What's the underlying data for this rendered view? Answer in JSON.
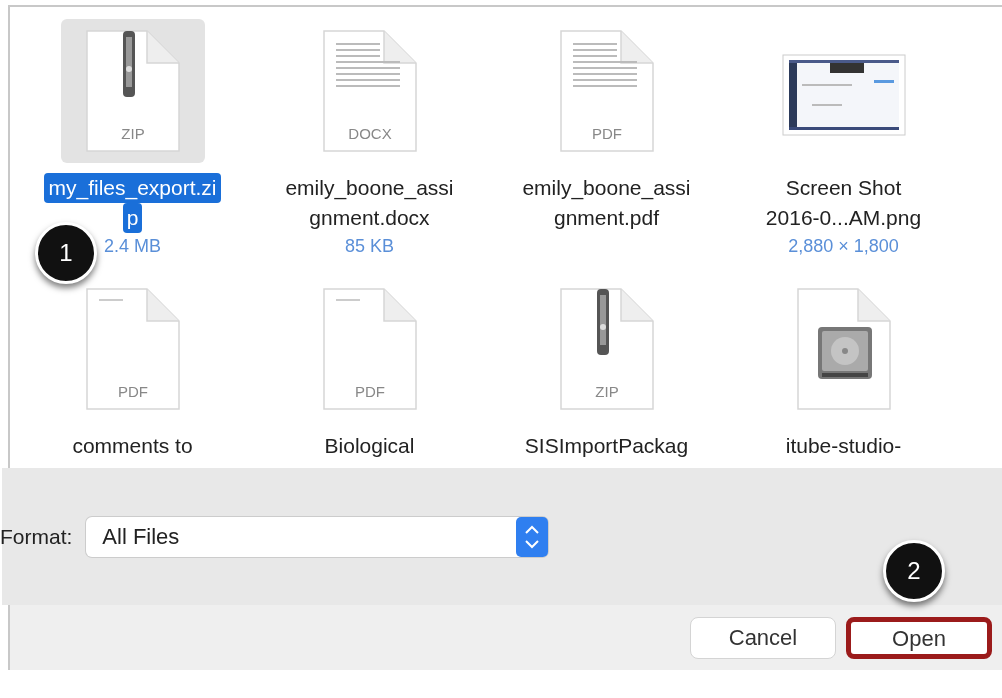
{
  "files": [
    {
      "kind": "zip",
      "badge": "ZIP",
      "name": [
        "my_files_export.zi",
        "p"
      ],
      "detail": "2.4 MB",
      "selected": true
    },
    {
      "kind": "doc",
      "badge": "DOCX",
      "name": [
        "emily_boone_assi",
        "gnment.docx"
      ],
      "detail": "85 KB",
      "selected": false
    },
    {
      "kind": "doc",
      "badge": "PDF",
      "name": [
        "emily_boone_assi",
        "gnment.pdf"
      ],
      "selected": false
    },
    {
      "kind": "image",
      "name": [
        "Screen Shot",
        "2016-0...AM.png"
      ],
      "detail": "2,880 × 1,800",
      "selected": false
    },
    {
      "kind": "blank",
      "badge": "PDF",
      "name": [
        "comments to"
      ],
      "selected": false
    },
    {
      "kind": "blank",
      "badge": "PDF",
      "name": [
        "Biological"
      ],
      "selected": false
    },
    {
      "kind": "zip",
      "badge": "ZIP",
      "name": [
        "SISImportPackag"
      ],
      "selected": false
    },
    {
      "kind": "disk",
      "name": [
        "itube-studio-"
      ],
      "selected": false
    }
  ],
  "format": {
    "label": "Format:",
    "value": "All Files"
  },
  "buttons": [
    {
      "label": "Cancel",
      "highlighted": false
    },
    {
      "label": "Open",
      "highlighted": true
    }
  ],
  "callouts": [
    {
      "label": "1"
    },
    {
      "label": "2"
    }
  ]
}
